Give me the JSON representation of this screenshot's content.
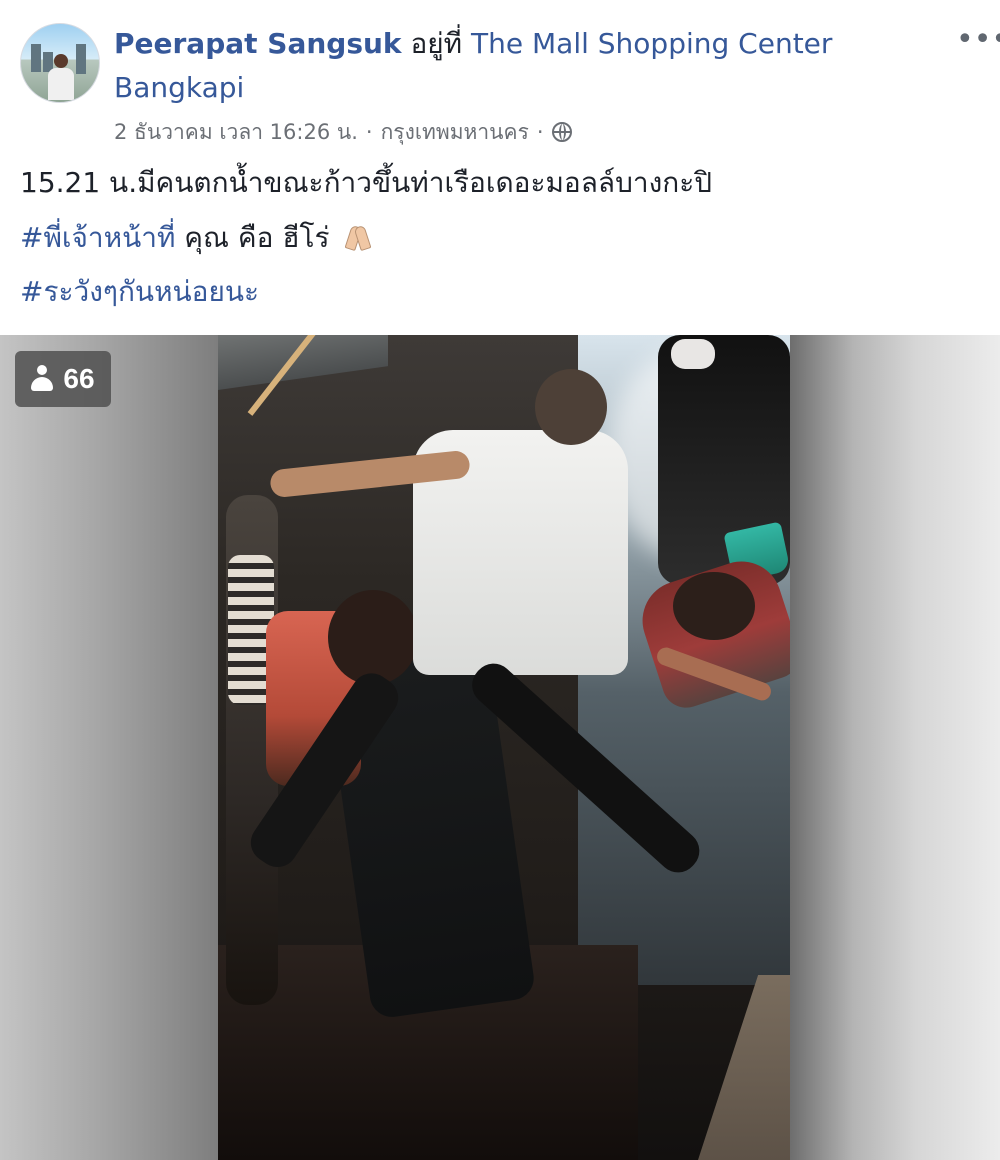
{
  "post": {
    "author": {
      "name": "Peerapat Sangsuk",
      "connector": " อยู่ที่ ",
      "location_line1": "The Mall Shopping Center",
      "location_line2": "Bangkapi"
    },
    "meta": {
      "date": "2 ธันวาคม เวลา 16:26 น.",
      "separator1": "·",
      "city": "กรุงเทพมหานคร",
      "separator2": "·",
      "privacy_icon": "globe-icon"
    },
    "more_label": "•••",
    "body": {
      "line1": "15.21 น.มีคนตกน้ำขณะก้าวขึ้นท่าเรือเดอะมอลล์บางกะปิ",
      "tag1": "#พี่เจ้าหน้าที่",
      "line2_rest": " คุณ คือ ฮีโร่ ",
      "line2_icon": "pray-icon",
      "tag2": "#ระวังๆกันหน่อยนะ"
    }
  },
  "video": {
    "viewers_icon": "person-icon",
    "viewers_count": "66"
  }
}
